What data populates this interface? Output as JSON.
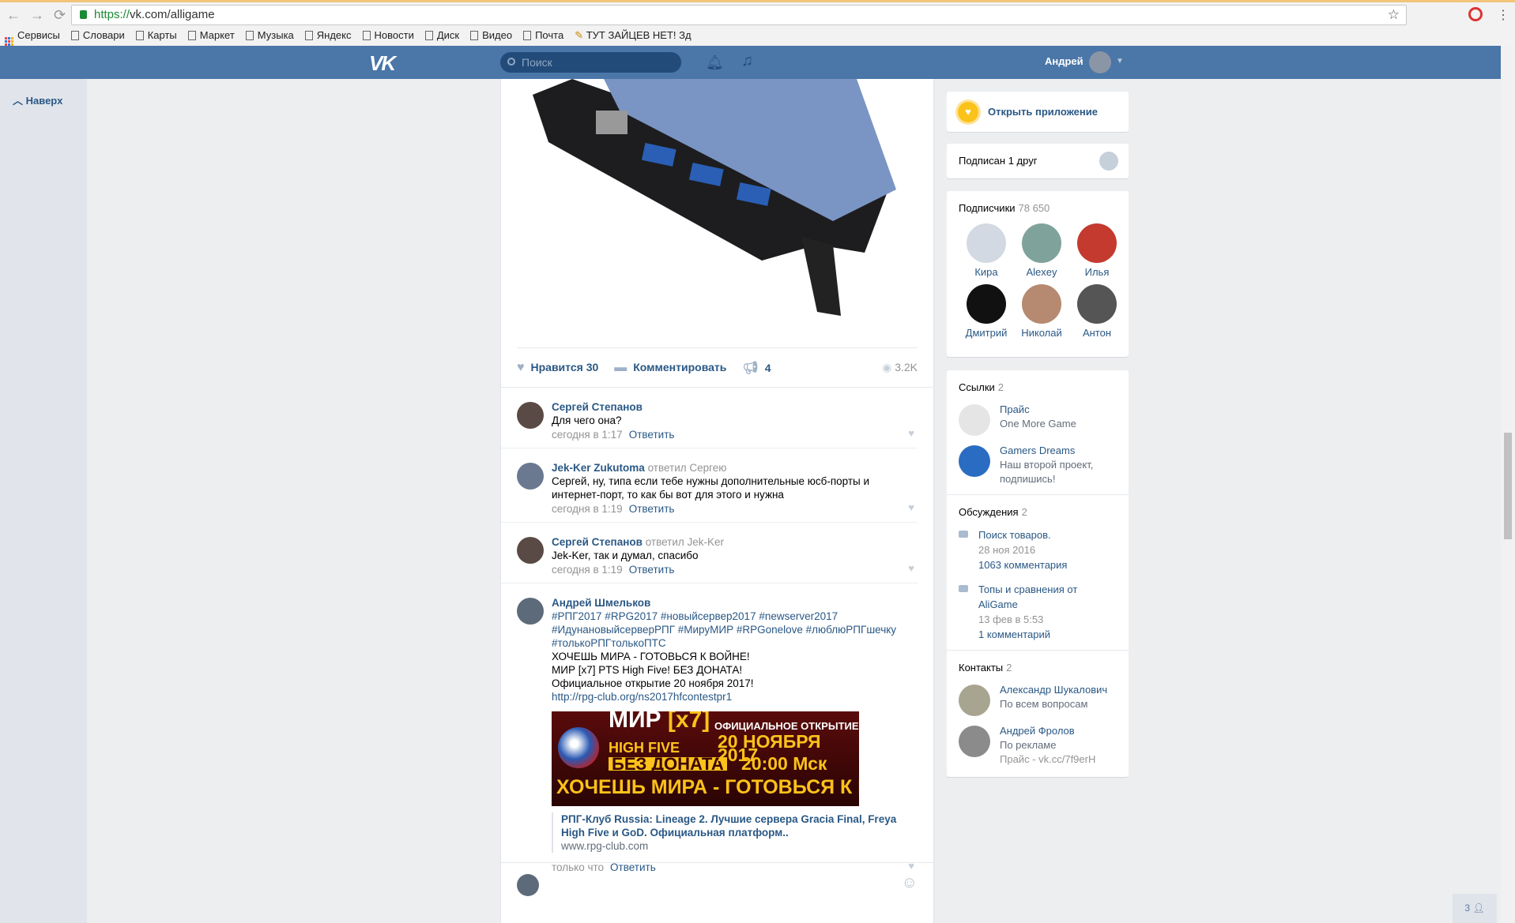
{
  "browser": {
    "url_scheme": "https://",
    "url_rest": "vk.com/alligame",
    "bookmarks": [
      "Сервисы",
      "Словари",
      "Карты",
      "Маркет",
      "Музыка",
      "Яндекс",
      "Новости",
      "Диск",
      "Видео",
      "Почта",
      "ТУТ ЗАЙЦЕВ НЕТ! Зд"
    ]
  },
  "header": {
    "logo": "VK",
    "search_placeholder": "Поиск",
    "user": "Андрей"
  },
  "sidebar": {
    "up": "Наверх"
  },
  "post": {
    "like_label": "Нравится",
    "likes": "30",
    "comment_label": "Комментировать",
    "shares": "4",
    "views": "3.2K"
  },
  "comments": [
    {
      "name": "Сергей Степанов",
      "reply": "",
      "text": "Для чего она?",
      "time": "сегодня в 1:17",
      "reply_label": "Ответить"
    },
    {
      "name": "Jek-Ker Zukutoma",
      "reply": "ответил Сергею",
      "text": "Сергей, ну, типа если тебе нужны дополнительные юсб-порты и интернет-порт, то как бы вот для этого и нужна",
      "time": "сегодня в 1:19",
      "reply_label": "Ответить"
    },
    {
      "name": "Сергей Степанов",
      "reply": "ответил Jek-Ker",
      "text": "Jek-Ker, так и думал, спасибо",
      "time": "сегодня в 1:19",
      "reply_label": "Ответить"
    }
  ],
  "last_comment": {
    "name": "Андрей Шмельков",
    "hashtags": [
      "#РПГ2017 #RPG2017 #новыйсервер2017 #newserver2017",
      "#ИдунановыйсерверРПГ #МируМИР #RPGonelove #люблюРПГшечку",
      "#толькоРПГтолькоПТС"
    ],
    "lines": [
      "ХОЧЕШЬ МИРА - ГОТОВЬСЯ К ВОЙНЕ!",
      "МИР [x7] PTS High Five! БЕЗ ДОНАТА!",
      "Официальное открытие 20 ноября 2017!"
    ],
    "link": "http://rpg-club.org/ns2017hfcontestpr1",
    "banner": {
      "mir": "МИР",
      "x7": "[x7]",
      "hf": "HIGH FIVE",
      "nodonate": "БЕЗ ДОНАТА",
      "open": "ОФИЦИАЛЬНОЕ ОТКРЫТИЕ",
      "date": "20 НОЯБРЯ 2017",
      "time": "20:00 Мск",
      "slogan": "ХОЧЕШЬ МИРА - ГОТОВЬСЯ К ВОЙНЕ"
    },
    "snippet_title": "РПГ-Клуб Russia: Lineage 2. Лучшие сервера Gracia Final, Freya High Five и GoD. Официальная платформ..",
    "snippet_url": "www.rpg-club.com",
    "time": "только что",
    "reply_label": "Ответить"
  },
  "right": {
    "open_app": "Открыть приложение",
    "friend_sub": "Подписан 1 друг",
    "subscribers": {
      "title": "Подписчики",
      "count": "78 650",
      "people": [
        "Кира",
        "Alexey",
        "Илья",
        "Дмитрий",
        "Николай",
        "Антон"
      ]
    },
    "links": {
      "title": "Ссылки",
      "count": "2",
      "items": [
        {
          "name": "Прайс",
          "desc": "One More Game"
        },
        {
          "name": "Gamers Dreams",
          "desc": "Наш второй проект, подпишись!"
        }
      ]
    },
    "discussions": {
      "title": "Обсуждения",
      "count": "2",
      "items": [
        {
          "name": "Поиск товаров.",
          "date": "28 ноя 2016",
          "comments": "1063 комментария"
        },
        {
          "name": "Топы и сравнения от AliGame",
          "date": "13 фев в 5:53",
          "comments": "1 комментарий"
        }
      ]
    },
    "contacts": {
      "title": "Контакты",
      "count": "2",
      "items": [
        {
          "name": "Александр Шукалович",
          "desc": "По всем вопросам",
          "extra": ""
        },
        {
          "name": "Андрей Фролов",
          "desc": "По рекламе",
          "extra": "Прайс - vk.cc/7f9erH"
        }
      ]
    }
  },
  "online_badge": "3",
  "colors": {
    "vk_blue": "#4a76a8",
    "link": "#2a5885",
    "bg": "#edeef0"
  }
}
